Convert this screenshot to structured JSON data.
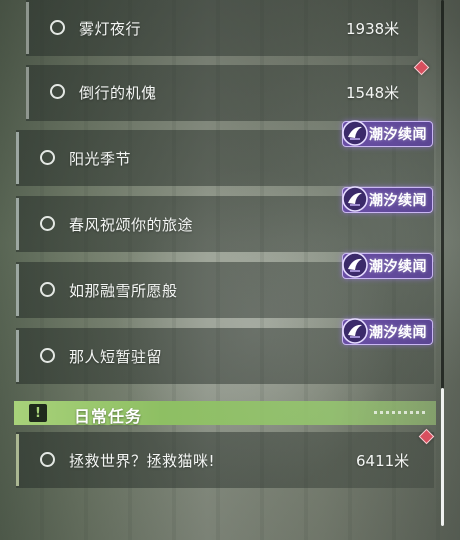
{
  "quests": {
    "items": [
      {
        "title": "雾灯夜行",
        "distance": "1938米"
      },
      {
        "title": "倒行的机傀",
        "distance": "1548米"
      },
      {
        "title": "阳光季节",
        "tag": "潮汐续闻"
      },
      {
        "title": "春风祝颂你的旅途",
        "tag": "潮汐续闻"
      },
      {
        "title": "如那融雪所愿般",
        "tag": "潮汐续闻"
      },
      {
        "title": "那人短暂驻留",
        "tag": "潮汐续闻"
      }
    ]
  },
  "daily_section": {
    "icon": "exclamation-icon",
    "title": "日常任务",
    "items": [
      {
        "title": "拯救世界？拯救猫咪!",
        "distance": "6411米"
      }
    ]
  },
  "colors": {
    "tag_purple": "#6a4fa6",
    "section_green": "#a8d27a",
    "marker_red": "#d84f5e"
  }
}
